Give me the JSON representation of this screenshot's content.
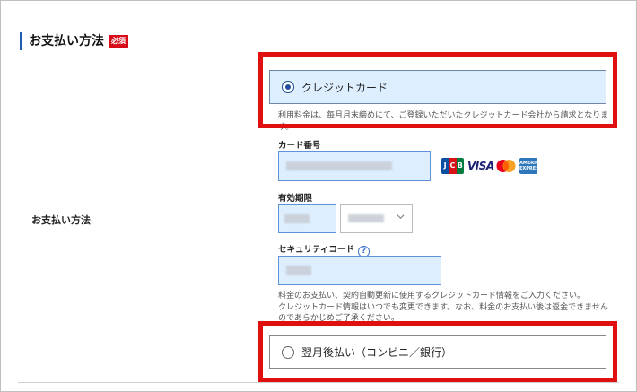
{
  "section": {
    "title": "お支払い方法",
    "required_badge": "必須"
  },
  "row_label": "お支払い方法",
  "options": {
    "credit": {
      "label": "クレジットカード",
      "selected": true
    },
    "deferred": {
      "label": "翌月後払い（コンビニ／銀行）",
      "selected": false
    }
  },
  "notes": {
    "credit_note": "利用料金は、毎月月末締めにて、ご登録いただいたクレジットカード会社から請求となります。",
    "card_info_note_line1": "料金のお支払い、契約自動更新に使用するクレジットカード情報をご入力ください。",
    "card_info_note_line2": "クレジットカード情報はいつでも変更できます。なお、料金のお支払い後は返金できませんのであらかじめご了承ください。"
  },
  "fields": {
    "card_number_label": "カード番号",
    "expiry_label": "有効期限",
    "security_code_label": "セキュリティコード",
    "security_help": "?"
  },
  "brands": {
    "jcb": [
      "J",
      "C",
      "B"
    ],
    "visa": "VISA",
    "amex": "AMERICAN EXPRESS"
  },
  "colors": {
    "highlight": "#e01010",
    "accent": "#1f5bb5",
    "required": "#d80c18",
    "input_bg": "#ddeeff"
  }
}
